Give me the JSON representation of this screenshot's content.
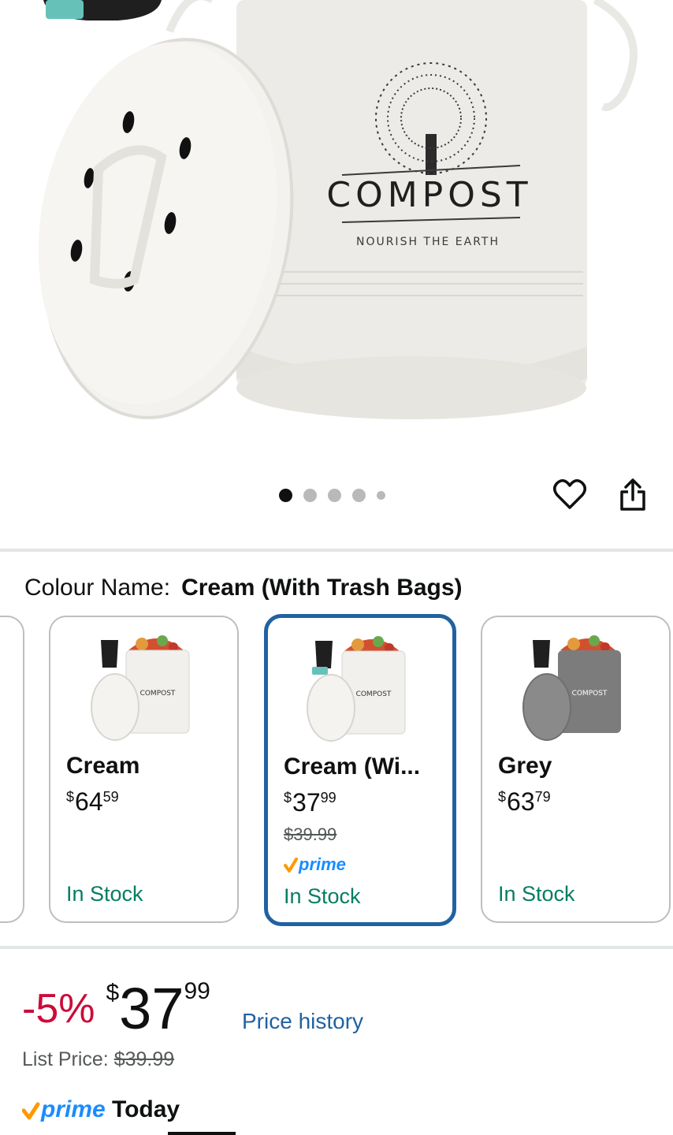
{
  "gallery": {
    "logo_title": "COMPOST",
    "logo_tagline": "NOURISH THE EARTH",
    "dots_count": 5,
    "active_dot": 0
  },
  "actions": {
    "favorite_icon": "heart-icon",
    "share_icon": "share-icon"
  },
  "colour": {
    "label": "Colour Name:",
    "selected_value": "Cream (With Trash Bags)"
  },
  "swatches": [
    {
      "name": "Cream",
      "price_whole": "64",
      "price_cents": "59",
      "currency": "$",
      "stock": "In Stock",
      "body_color": "#f1f0ec"
    },
    {
      "name": "Cream (Wi...",
      "price_whole": "37",
      "price_cents": "99",
      "currency": "$",
      "was_price": "$39.99",
      "prime_label": "prime",
      "stock": "In Stock",
      "body_color": "#f1f0ec"
    },
    {
      "name": "Grey",
      "price_whole": "63",
      "price_cents": "79",
      "currency": "$",
      "stock": "In Stock",
      "body_color": "#7c7c7c"
    }
  ],
  "pricing": {
    "discount": "-5%",
    "currency": "$",
    "price_whole": "37",
    "price_cents": "99",
    "price_history_link": "Price history",
    "list_price_label": "List Price:",
    "list_price_value": "$39.99",
    "prime_label": "prime",
    "delivery": "Today"
  },
  "colors": {
    "discount_red": "#cc0c39",
    "link_blue": "#2162a1",
    "stock_green": "#067d62",
    "prime_blue": "#1a8cff",
    "prime_orange": "#ff9900",
    "selected_border": "#2162a1"
  }
}
